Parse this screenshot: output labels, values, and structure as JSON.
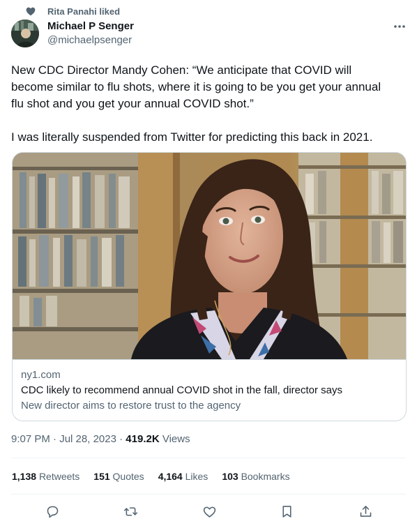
{
  "social_context": {
    "text": "Rita Panahi liked",
    "icon": "heart-icon"
  },
  "author": {
    "display_name": "Michael P Senger",
    "handle": "@michaelpsenger"
  },
  "tweet": {
    "paragraphs": [
      "New CDC Director Mandy Cohen: “We anticipate that COVID will\nbecome similar to flu shots, where it is going to be you get your annual\nflu shot and you get your annual COVID shot.”",
      "I was literally suspended from Twitter for predicting this back in 2021."
    ]
  },
  "card": {
    "domain": "ny1.com",
    "title": "CDC likely to recommend annual COVID shot in the fall, director says",
    "description": "New director aims to restore trust to the agency"
  },
  "meta": {
    "time": "9:07 PM",
    "date": "Jul 28, 2023",
    "views_count": "419.2K",
    "views_label": "Views"
  },
  "stats": {
    "retweets": {
      "count": "1,138",
      "label": "Retweets"
    },
    "quotes": {
      "count": "151",
      "label": "Quotes"
    },
    "likes": {
      "count": "4,164",
      "label": "Likes"
    },
    "bookmarks": {
      "count": "103",
      "label": "Bookmarks"
    }
  },
  "colors": {
    "text": "#0f1419",
    "secondary": "#536471",
    "border": "#cfd9de",
    "divider": "#eff3f4"
  }
}
